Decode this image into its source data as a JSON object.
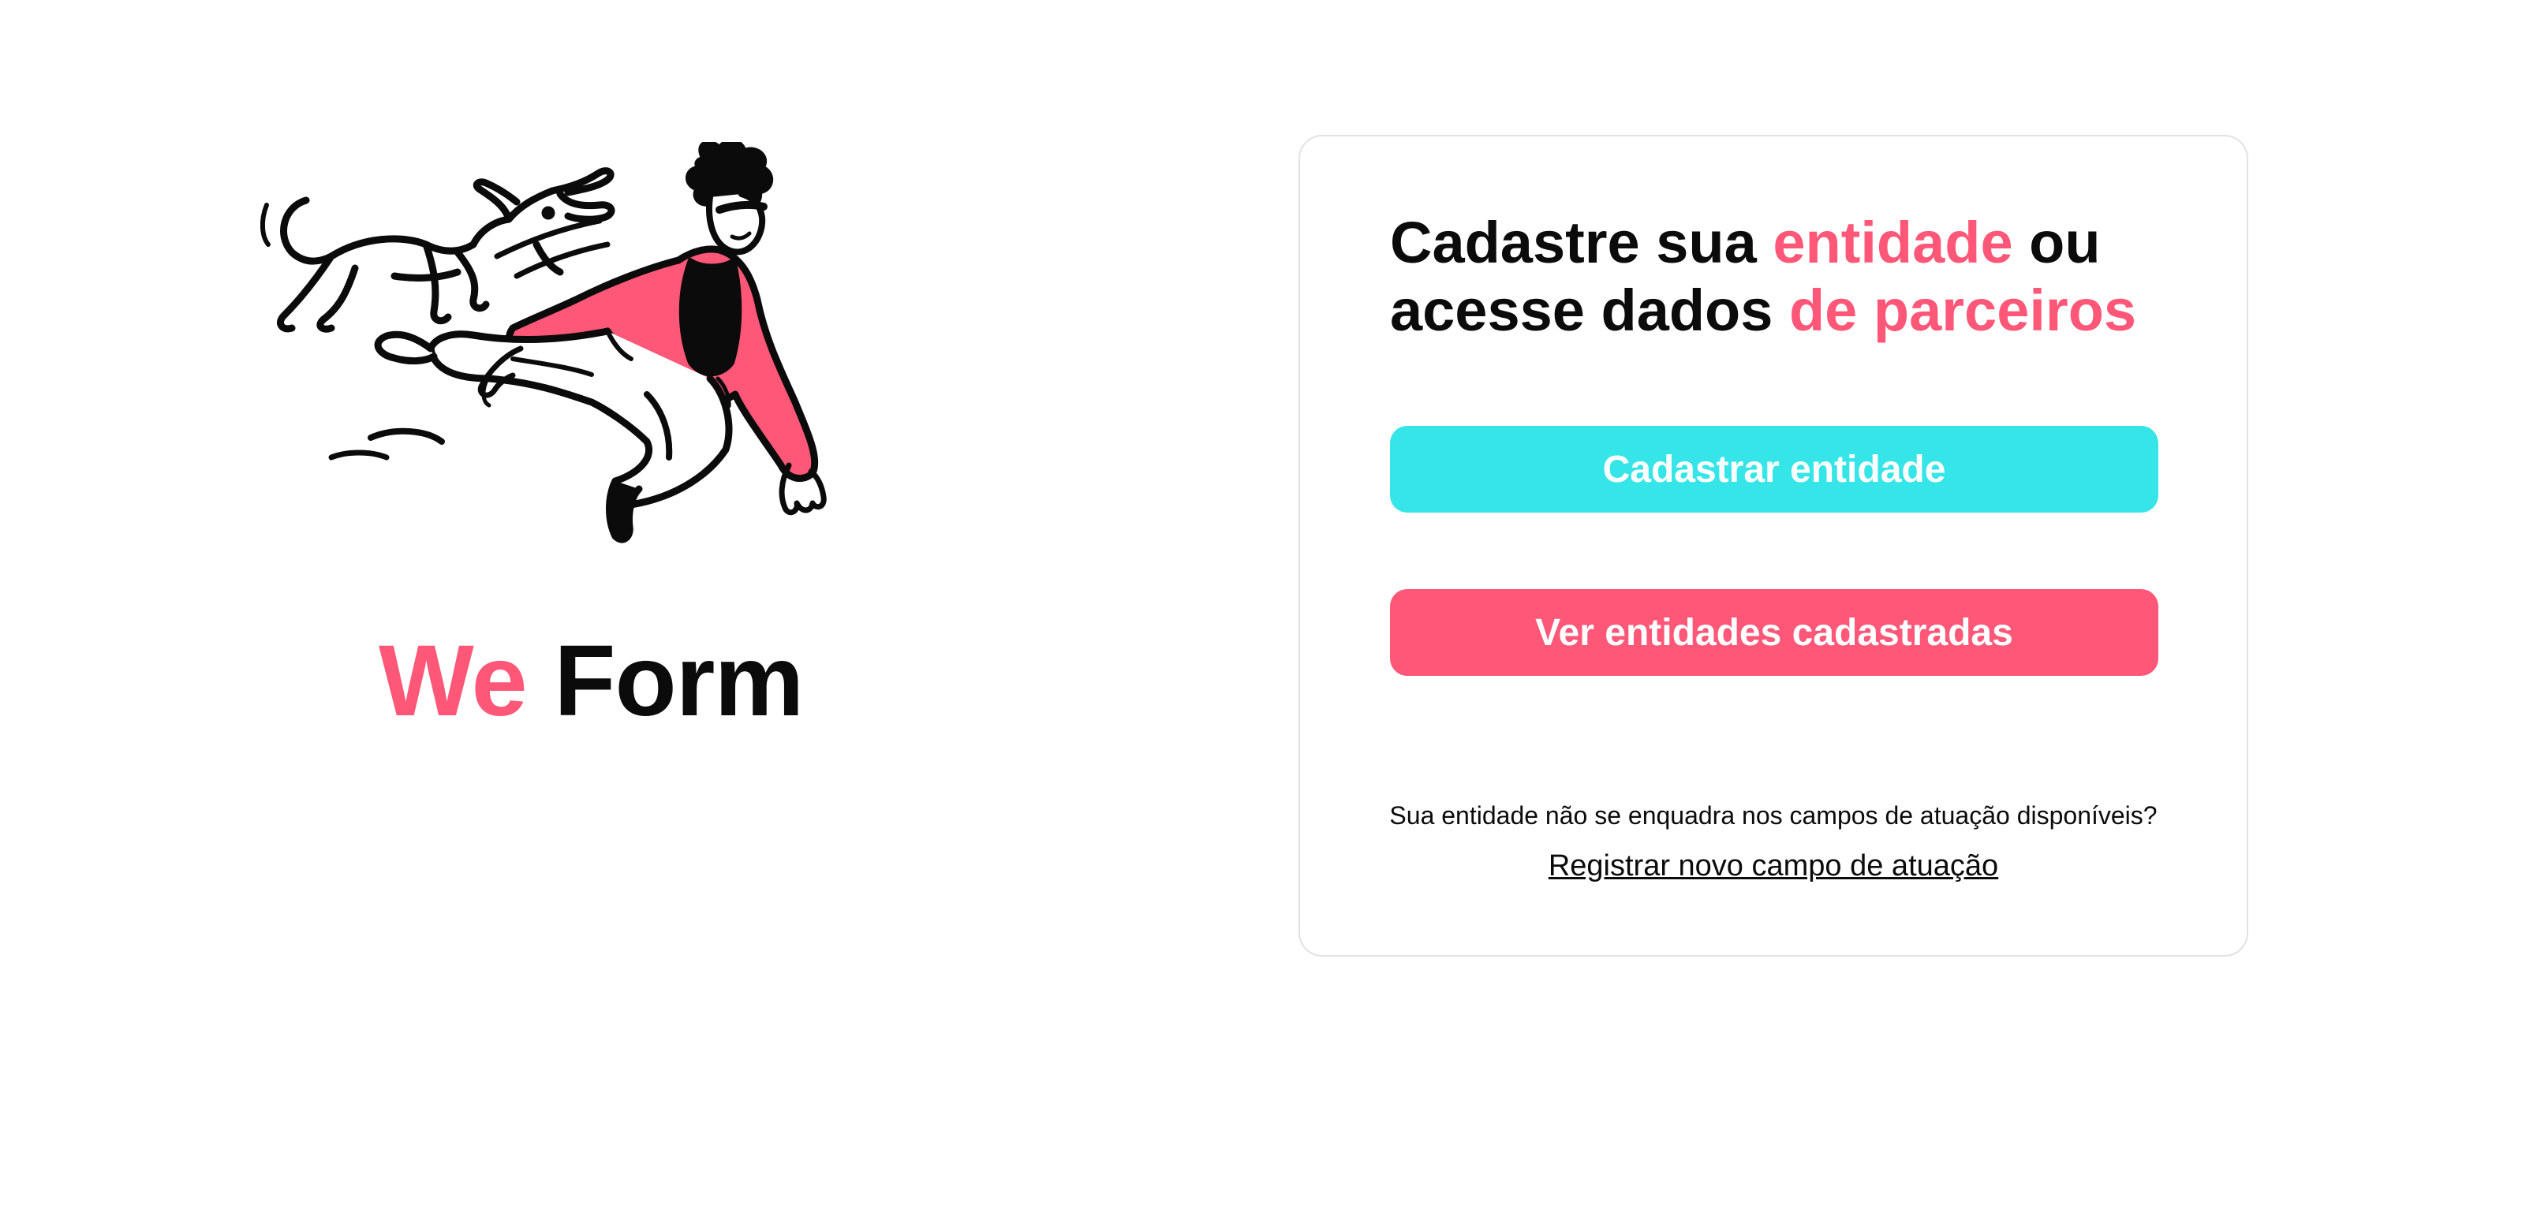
{
  "brand": {
    "part1": "We",
    "part2": "Form"
  },
  "card": {
    "title": {
      "line1_a": "Cadastre sua ",
      "line1_accent": "entidade",
      "line1_b": " ou",
      "line2_a": "acesse dados ",
      "line2_accent": "de parceiros"
    },
    "register_button": "Cadastrar entidade",
    "view_button": "Ver entidades cadastradas",
    "footer_question": "Sua entidade não se enquadra nos campos de atuação disponíveis?",
    "footer_link": "Registrar novo campo de atuação"
  },
  "colors": {
    "accent": "#ff5777",
    "cyan": "#36e5e8",
    "text": "#0b0b0b"
  },
  "icons": {
    "illustration": "person-jumping-with-dog-illustration"
  }
}
